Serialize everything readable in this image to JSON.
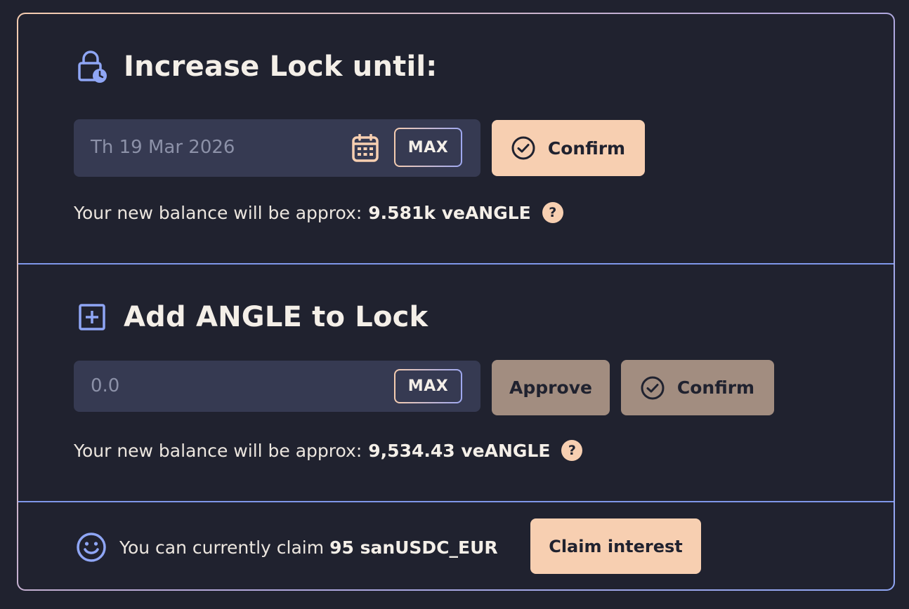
{
  "increase_lock": {
    "title": "Increase Lock until:",
    "date_value": "Th 19 Mar 2026",
    "max_label": "MAX",
    "confirm_label": "Confirm",
    "balance_prefix": "Your new balance will be approx:",
    "balance_value": "9.581k veANGLE",
    "help_glyph": "?"
  },
  "add_angle": {
    "title": "Add ANGLE to Lock",
    "amount_placeholder": "0.0",
    "max_label": "MAX",
    "approve_label": "Approve",
    "confirm_label": "Confirm",
    "balance_prefix": "Your new balance will be approx:",
    "balance_value": "9,534.43 veANGLE",
    "help_glyph": "?"
  },
  "claim": {
    "prefix": "You can currently claim",
    "amount": "95 sanUSDC_EUR",
    "button_label": "Claim interest"
  },
  "colors": {
    "background": "#20222f",
    "accent_peach": "#f7cfb1",
    "accent_blue": "#7f97ea",
    "input_bg": "#363a52",
    "muted_button": "#a28d80"
  },
  "icons": {
    "lock_title": "lock-clock-icon",
    "add_title": "plus-square-icon",
    "calendar": "calendar-icon",
    "confirm": "check-circle-icon",
    "help": "question-icon",
    "claim": "smile-icon"
  }
}
